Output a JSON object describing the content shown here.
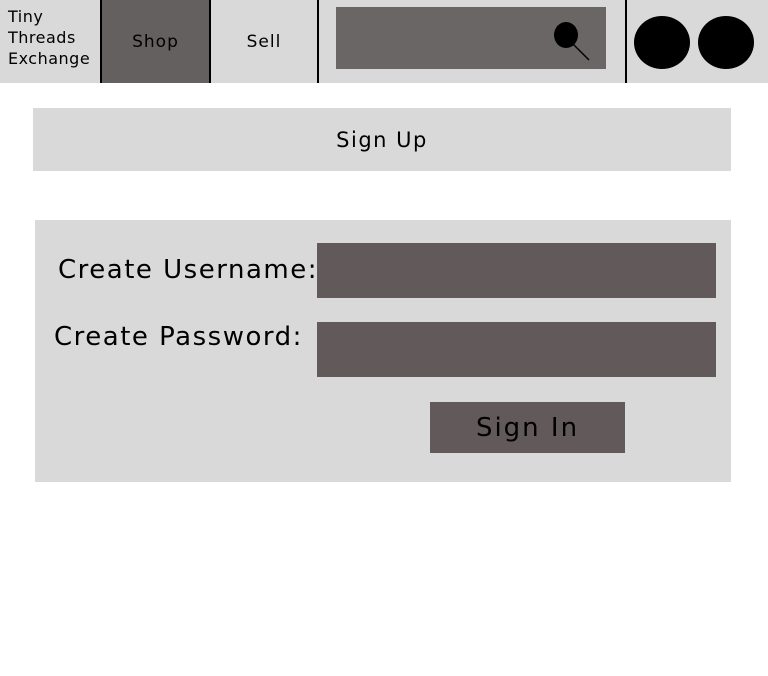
{
  "header": {
    "brand": "Tiny\nThreads\nExchange",
    "tabs": [
      {
        "label": "Shop",
        "active": true
      },
      {
        "label": "Sell",
        "active": false
      }
    ],
    "search": {
      "icon": "search-icon",
      "placeholder": ""
    },
    "avatars": [
      "avatar-icon",
      "avatar-icon"
    ]
  },
  "banner": {
    "title": "Sign Up"
  },
  "form": {
    "username_label": "Create Username:",
    "username_value": "",
    "password_label": "Create Password:",
    "password_value": "",
    "submit_label": "Sign In"
  },
  "colors": {
    "panel": "#d9d9d9",
    "dark": "#625a5a",
    "ink": "#000000"
  }
}
